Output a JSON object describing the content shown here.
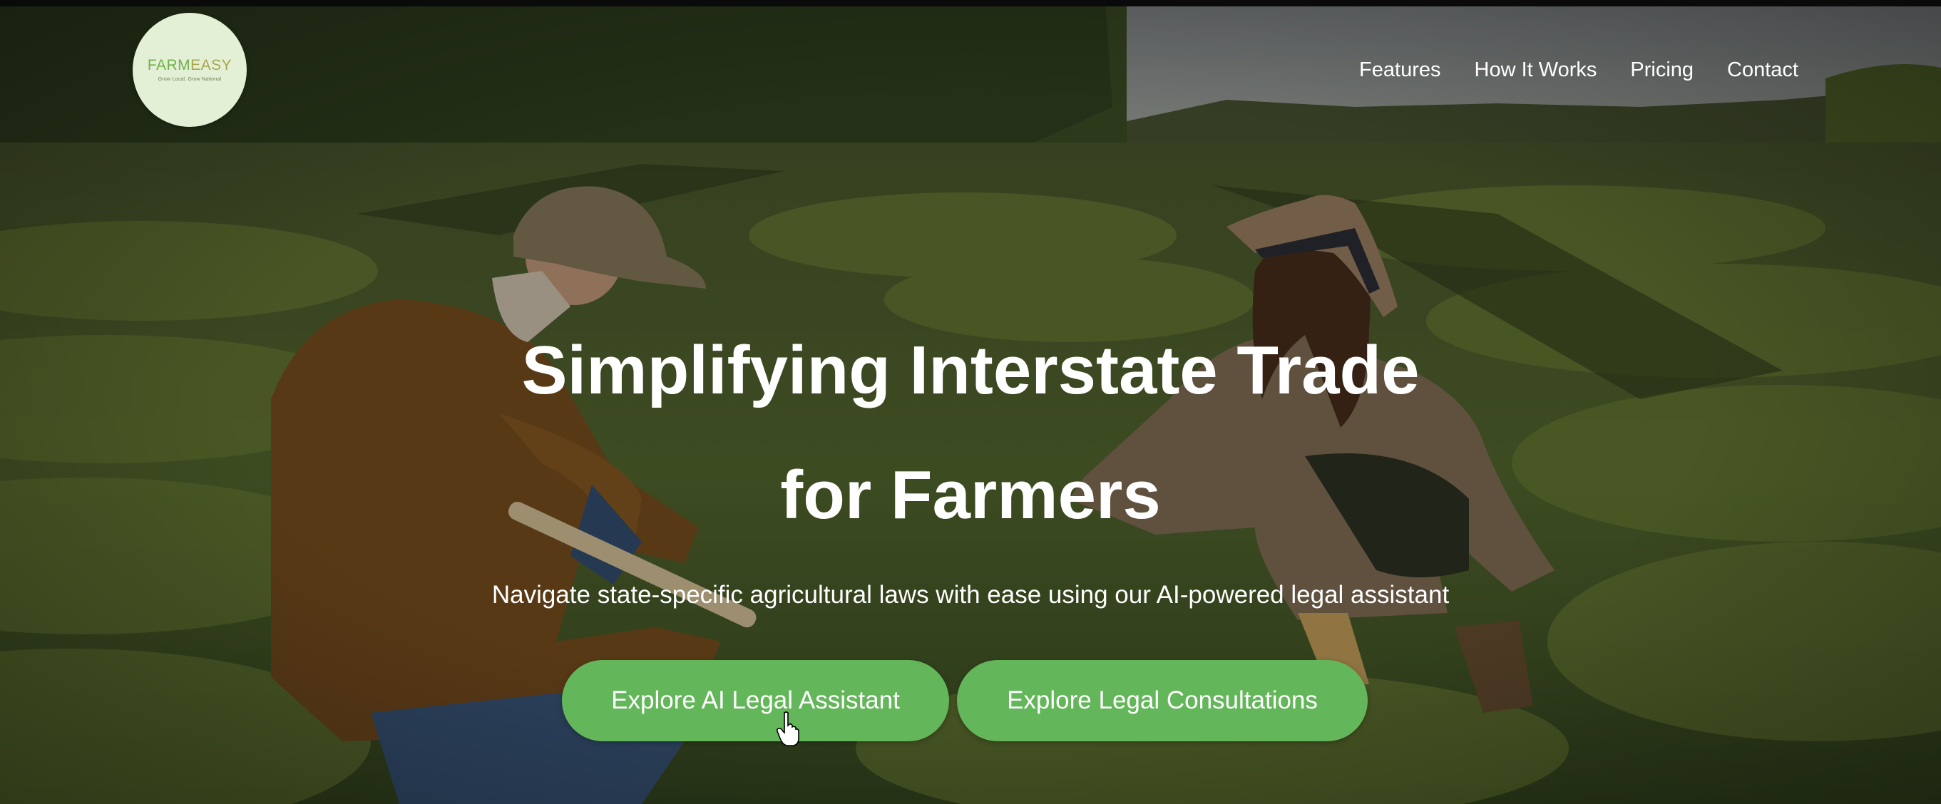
{
  "logo": {
    "brand_part1": "FARM",
    "brand_part2": "EASY",
    "tagline": "Grow Local, Grow National"
  },
  "nav": {
    "items": [
      {
        "label": "Features"
      },
      {
        "label": "How It Works"
      },
      {
        "label": "Pricing"
      },
      {
        "label": "Contact"
      }
    ]
  },
  "hero": {
    "headline_line1": "Simplifying Interstate Trade",
    "headline_line2": "for Farmers",
    "subtitle": "Navigate state-specific agricultural laws with ease using our AI-powered legal assistant",
    "background": "farm-field-two-farmers-photo"
  },
  "buttons": {
    "primary_label": "Explore AI Legal Assistant",
    "secondary_label": "Explore Legal Consultations"
  },
  "colors": {
    "button_green": "#64b65a",
    "logo_bg": "#e4f0d6",
    "logo_farm": "#6fb04a",
    "logo_easy": "#a7a64e",
    "text": "#ffffff"
  }
}
